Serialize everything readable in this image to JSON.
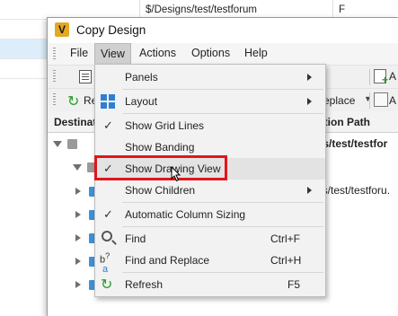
{
  "background_app": {
    "path_value": "$/Designs/test/testforum",
    "f_value": "F"
  },
  "window": {
    "title": "Copy Design",
    "app_icon_letter": "V"
  },
  "menubar": {
    "items": [
      {
        "label": "File"
      },
      {
        "label": "View",
        "active": true
      },
      {
        "label": "Actions"
      },
      {
        "label": "Options"
      },
      {
        "label": "Help"
      }
    ]
  },
  "toolbar": {
    "refresh_partial": "Re",
    "replace_partial": "eplace",
    "a_partial": "A"
  },
  "grid": {
    "col_destination": "Destinat",
    "col_path": "ation Path",
    "rows": [
      {
        "path": "ns/test/testfor",
        "bold": true
      },
      {
        "path": "",
        "bold": false
      },
      {
        "path": "ns/test/testforu.",
        "bold": false
      }
    ]
  },
  "view_menu": {
    "items": [
      {
        "label": "Panels",
        "submenu": true
      },
      {
        "label": "Layout",
        "submenu": true,
        "icon": "layout-icon"
      },
      {
        "label": "Show Grid Lines",
        "checked": true
      },
      {
        "label": "Show Banding"
      },
      {
        "label": "Show Drawing View",
        "checked": true,
        "highlighted": true
      },
      {
        "label": "Show Children",
        "submenu": true
      },
      {
        "label": "Automatic Column Sizing",
        "checked": true
      },
      {
        "label": "Find",
        "shortcut": "Ctrl+F",
        "icon": "magnifier-icon"
      },
      {
        "label": "Find and Replace",
        "shortcut": "Ctrl+H",
        "icon": "find-replace-icon"
      },
      {
        "label": "Refresh",
        "shortcut": "F5",
        "icon": "refresh-icon"
      }
    ]
  },
  "colors": {
    "highlight_border": "#e0161b",
    "accent_blue": "#2f7fd1",
    "refresh_green": "#2a9d2a"
  }
}
